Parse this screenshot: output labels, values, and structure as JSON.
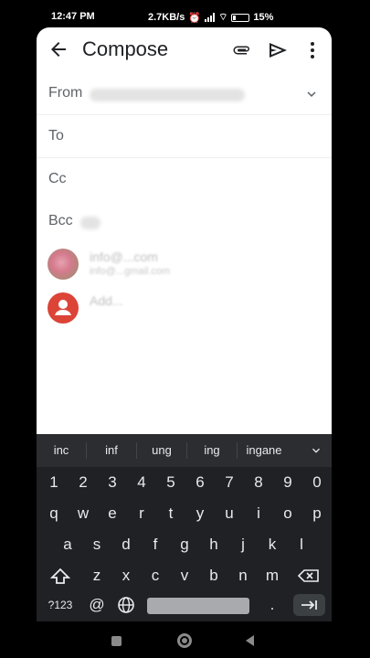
{
  "status_bar": {
    "time": "12:47 PM",
    "speed": "2.7KB/s",
    "battery": "15%"
  },
  "compose": {
    "title": "Compose",
    "fields": {
      "from_label": "From",
      "to_label": "To",
      "cc_label": "Cc",
      "bcc_label": "Bcc"
    },
    "suggestions": [
      {
        "name": "info@...com",
        "email": "info@...gmail.com",
        "avatar": "photo"
      },
      {
        "name": "Add...",
        "email": "",
        "avatar": "person-icon"
      }
    ]
  },
  "keyboard": {
    "suggestions": [
      "inc",
      "inf",
      "ung",
      "ing",
      "ingane"
    ],
    "number_row": [
      "1",
      "2",
      "3",
      "4",
      "5",
      "6",
      "7",
      "8",
      "9",
      "0"
    ],
    "row1": [
      "q",
      "w",
      "e",
      "r",
      "t",
      "y",
      "u",
      "i",
      "o",
      "p"
    ],
    "row2": [
      "a",
      "s",
      "d",
      "f",
      "g",
      "h",
      "j",
      "k",
      "l"
    ],
    "row3": [
      "z",
      "x",
      "c",
      "v",
      "b",
      "n",
      "m"
    ],
    "symbols_label": "?123",
    "at_key": "@",
    "period_key": "."
  },
  "colors": {
    "accent": "#5f6368",
    "keyboard_bg": "#202124",
    "avatar_red": "#db4437"
  }
}
